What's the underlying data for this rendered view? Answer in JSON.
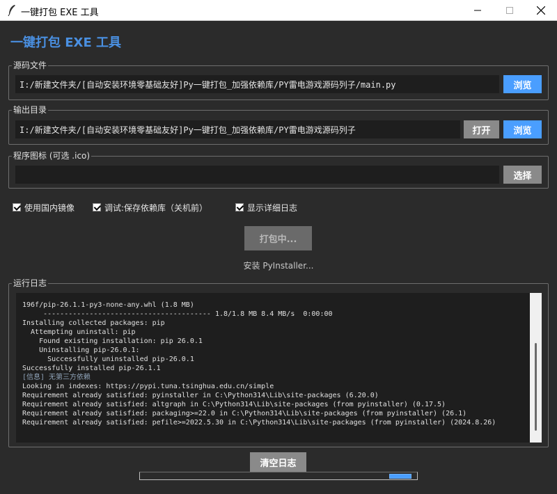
{
  "window": {
    "title": "一键打包 EXE 工具",
    "icon": "feather-icon"
  },
  "app_title": "一键打包 EXE 工具",
  "source": {
    "legend": "源码文件",
    "value": "I:/新建文件夹/[自动安装环境零基础友好]Py一键打包_加强依赖库/PY雷电游戏源码列子/main.py",
    "browse_label": "浏览"
  },
  "output": {
    "legend": "输出目录",
    "value": "I:/新建文件夹/[自动安装环境零基础友好]Py一键打包_加强依赖库/PY雷电游戏源码列子",
    "open_label": "打开",
    "browse_label": "浏览"
  },
  "icon_group": {
    "legend": "程序图标 (可选 .ico)",
    "value": "",
    "select_label": "选择"
  },
  "options": [
    {
      "label": "使用国内镜像",
      "checked": true
    },
    {
      "label": "调试:保存依赖库（关机前）",
      "checked": true
    },
    {
      "label": "显示详细日志",
      "checked": true
    }
  ],
  "pack_button_label": "打包中...",
  "status_text": "安装 PyInstaller...",
  "log": {
    "legend": "运行日志",
    "lines": [
      "196f/pip-26.1.1-py3-none-any.whl (1.8 MB)",
      "     ---------------------------------------- 1.8/1.8 MB 8.4 MB/s  0:00:00",
      "Installing collected packages: pip",
      "  Attempting uninstall: pip",
      "    Found existing installation: pip 26.0.1",
      "    Uninstalling pip-26.0.1:",
      "      Successfully uninstalled pip-26.0.1",
      "Successfully installed pip-26.1.1",
      "[信息] 无第三方依赖",
      "Looking in indexes: https://pypi.tuna.tsinghua.edu.cn/simple",
      "Requirement already satisfied: pyinstaller in C:\\Python314\\Lib\\site-packages (6.20.0)",
      "Requirement already satisfied: altgraph in C:\\Python314\\Lib\\site-packages (from pyinstaller) (0.17.5)",
      "Requirement already satisfied: packaging>=22.0 in C:\\Python314\\Lib\\site-packages (from pyinstaller) (26.1)",
      "Requirement already satisfied: pefile>=2022.5.30 in C:\\Python314\\Lib\\site-packages (from pyinstaller) (2024.8.26)"
    ]
  },
  "clear_log_label": "清空日志",
  "progress": {
    "mode": "indeterminate",
    "color": "#4a9eff"
  },
  "colors": {
    "accent": "#4a90e2",
    "button_blue": "#4a9eff",
    "button_gray": "#8a8a8a",
    "background": "#2b2b2b"
  }
}
